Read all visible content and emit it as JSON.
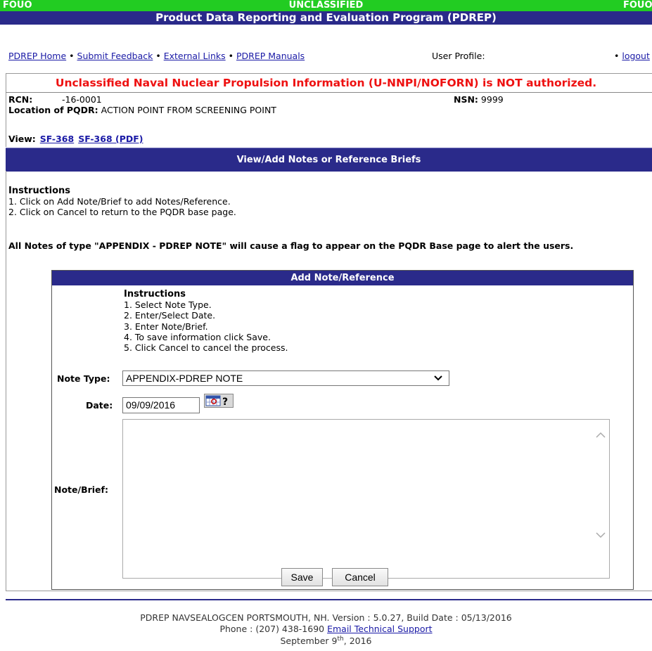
{
  "banner": {
    "left": "FOUO",
    "center": "UNCLASSIFIED",
    "right": "FOUO"
  },
  "app_title": "Product Data Reporting and Evaluation Program (PDREP)",
  "nav": {
    "links": [
      "PDREP Home",
      "Submit Feedback",
      "External Links",
      "PDREP Manuals"
    ],
    "separator": "•",
    "user_profile": "User Profile:",
    "logout": "logout"
  },
  "warning": "Unclassified Naval Nuclear Propulsion Information (U-NNPI/NOFORN) is NOT authorized.",
  "record": {
    "rcn_label": "RCN:",
    "rcn_value": "-16-0001",
    "nsn_label": "NSN:",
    "nsn_value": "9999",
    "location_label": "Location of PQDR:",
    "location_value": "ACTION POINT FROM SCREENING POINT"
  },
  "view": {
    "label": "View:",
    "links": [
      "SF-368",
      "SF-368 (PDF)"
    ]
  },
  "section_title": "View/Add Notes or Reference Briefs",
  "instructions": {
    "title": "Instructions",
    "items": [
      "1. Click on Add Note/Brief to add Notes/Reference.",
      "2. Click on Cancel to return to the PQDR base page."
    ]
  },
  "flag_note": "All Notes of type \"APPENDIX - PDREP NOTE\" will cause a flag to appear on the PQDR Base page to alert the users.",
  "form": {
    "title": "Add Note/Reference",
    "instructions_title": "Instructions",
    "instructions": [
      "1. Select Note Type.",
      "2. Enter/Select Date.",
      "3. Enter Note/Brief.",
      "4. To save information click Save.",
      "5. Click Cancel to cancel the process."
    ],
    "note_type_label": "Note Type:",
    "note_type_value": "APPENDIX-PDREP NOTE",
    "date_label": "Date:",
    "date_value": "09/09/2016",
    "note_brief_label": "Note/Brief:",
    "note_brief_value": "",
    "save_label": "Save",
    "cancel_label": "Cancel"
  },
  "footer": {
    "line1": "PDREP NAVSEALOGCEN PORTSMOUTH, NH.  Version : 5.0.27, Build Date : 05/13/2016",
    "phone": "Phone : (207) 438-1690",
    "email_link": "Email Technical Support",
    "date_pre": "September 9",
    "date_sup": "th",
    "date_post": ", 2016"
  }
}
